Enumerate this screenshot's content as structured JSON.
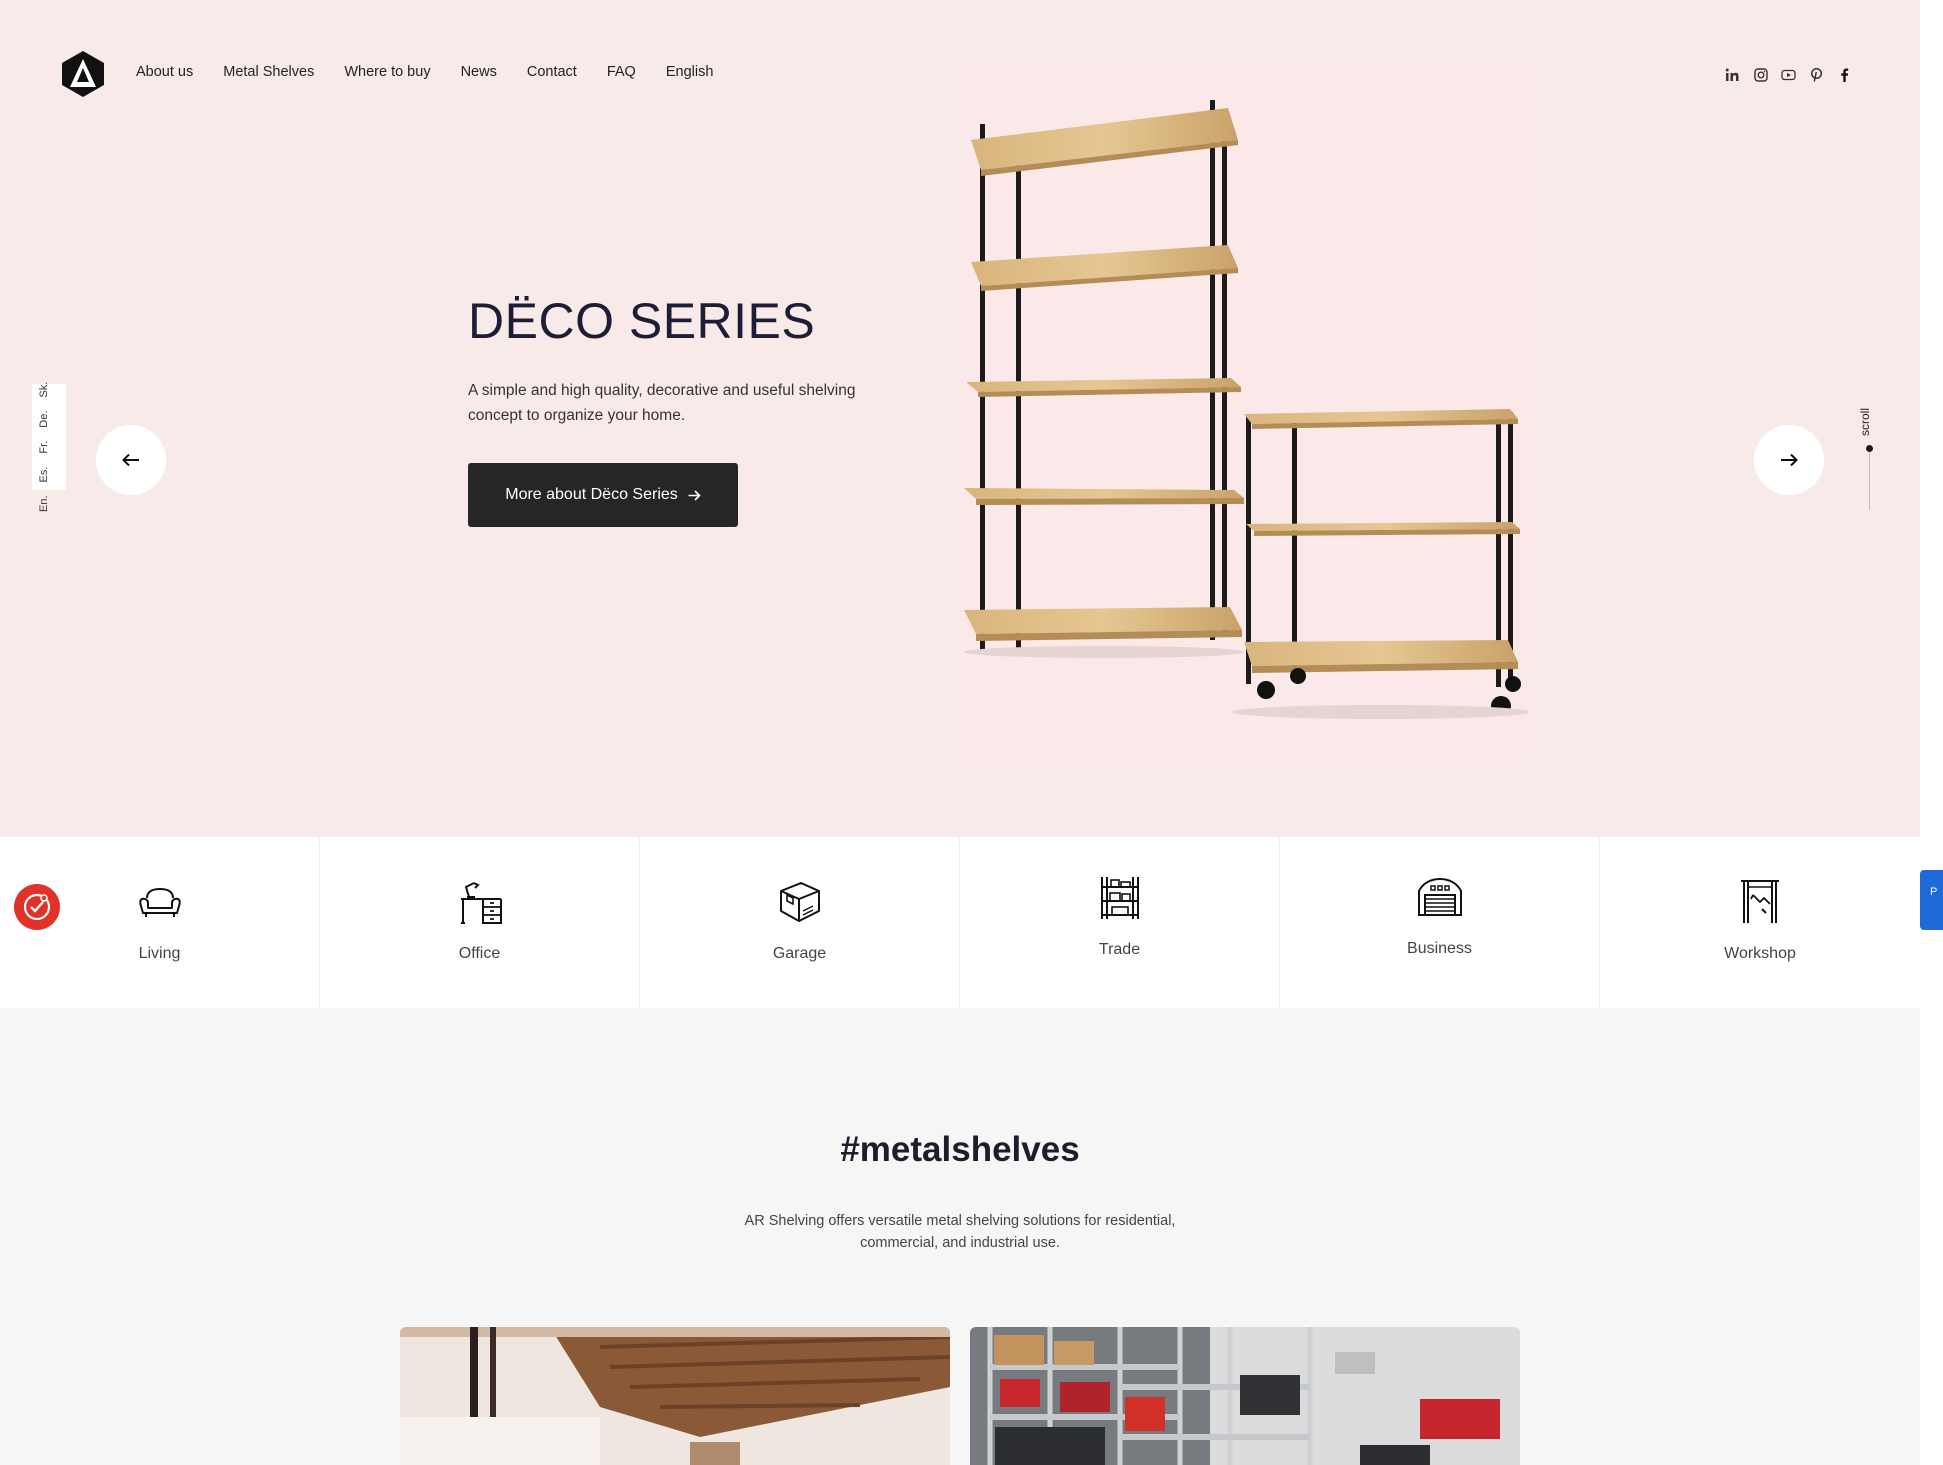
{
  "nav": {
    "items": [
      {
        "label": "About us"
      },
      {
        "label": "Metal Shelves"
      },
      {
        "label": "Where to buy"
      },
      {
        "label": "News"
      },
      {
        "label": "Contact"
      },
      {
        "label": "FAQ"
      },
      {
        "label": "English"
      }
    ]
  },
  "socials": [
    "linkedin-icon",
    "instagram-icon",
    "youtube-icon",
    "pinterest-icon",
    "facebook-icon"
  ],
  "languages": [
    "En.",
    "Es.",
    "Fr.",
    "De.",
    "Sk."
  ],
  "hero": {
    "title": "DËCO SERIES",
    "description": "A simple and high quality, decorative and useful shelving concept to organize your home.",
    "cta_label": "More about Dëco Series",
    "scroll_label": "scroll"
  },
  "categories": [
    {
      "label": "Living",
      "icon": "armchair-icon"
    },
    {
      "label": "Office",
      "icon": "desk-icon"
    },
    {
      "label": "Garage",
      "icon": "box-icon"
    },
    {
      "label": "Trade",
      "icon": "shelf-rack-icon"
    },
    {
      "label": "Business",
      "icon": "warehouse-icon"
    },
    {
      "label": "Workshop",
      "icon": "workshop-icon"
    }
  ],
  "section": {
    "title": "#metalshelves",
    "description": "AR Shelving offers versatile metal shelving solutions for residential, commercial, and industrial use."
  },
  "side_tab_label": "P",
  "colors": {
    "hero_bg": "#f9eaea",
    "cta_bg": "#262626",
    "cookie_red": "#e1322a",
    "side_tab_blue": "#1e6ad8"
  }
}
